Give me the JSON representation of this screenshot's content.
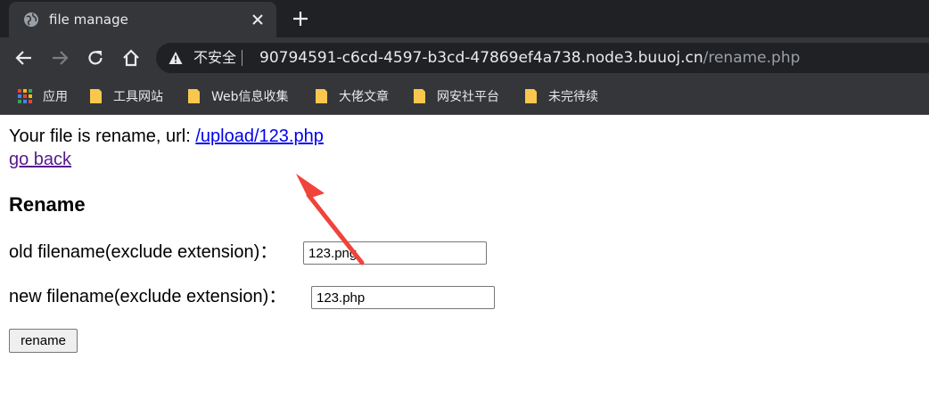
{
  "browser": {
    "tab": {
      "title": "file manage",
      "favicon": "globe-icon"
    },
    "address_bar": {
      "security_label": "不安全",
      "url_host": "90794591-c6cd-4597-b3cd-47869ef4a738.node3.buuoj.cn",
      "url_path": "/rename.php"
    },
    "bookmarks": {
      "apps_label": "应用",
      "folders": [
        "工具网站",
        "Web信息收集",
        "大佬文章",
        "网安社平台",
        "未完待续"
      ]
    },
    "colors": {
      "chrome_dark": "#202124",
      "chrome_mid": "#35363a",
      "folder": "#f9c74f",
      "annotation_arrow": "#f0433a"
    }
  },
  "page": {
    "result_prefix": "Your file is rename, url: ",
    "result_link": "/upload/123.php",
    "go_back": "go back",
    "heading": "Rename",
    "old_label": "old filename(exclude extension)：",
    "old_value": "123.png",
    "new_label": "new filename(exclude extension)：",
    "new_value": "123.php",
    "submit_label": "rename"
  }
}
